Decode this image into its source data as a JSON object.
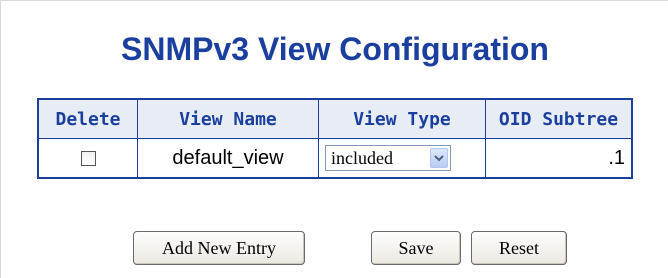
{
  "page": {
    "title": "SNMPv3 View Configuration"
  },
  "table": {
    "headers": {
      "delete": "Delete",
      "view_name": "View Name",
      "view_type": "View Type",
      "oid_subtree": "OID Subtree"
    },
    "rows": [
      {
        "delete_checked": false,
        "view_name": "default_view",
        "view_type": "included",
        "oid_subtree": ".1"
      }
    ]
  },
  "buttons": {
    "add_new_entry": "Add New Entry",
    "save": "Save",
    "reset": "Reset"
  },
  "colors": {
    "accent": "#1a3f9e",
    "header_bg": "#e8ecf5"
  },
  "icons": {
    "dropdown": "chevron-down-icon",
    "checkbox": "checkbox-icon"
  }
}
